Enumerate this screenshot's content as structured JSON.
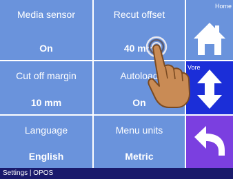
{
  "tiles": [
    {
      "label": "Media sensor",
      "value": "On"
    },
    {
      "label": "Recut offset",
      "value": "40 mm"
    },
    {
      "label": "Cut off margin",
      "value": "10 mm"
    },
    {
      "label": "Autoload",
      "value": "On"
    },
    {
      "label": "Language",
      "value": "English"
    },
    {
      "label": "Menu units",
      "value": "Metric"
    }
  ],
  "side": {
    "home_label": "Home",
    "move_label": "Vore"
  },
  "status": {
    "text": "Settings | OPOS"
  },
  "colors": {
    "tile": "#6a93dc",
    "home": "#6a93dc",
    "move": "#1b2ed8",
    "back": "#7b3fe0",
    "status_bar": "#1a1a6c"
  },
  "icons": [
    "home-icon",
    "up-down-arrow-icon",
    "back-arrow-icon",
    "pointing-hand-icon"
  ]
}
